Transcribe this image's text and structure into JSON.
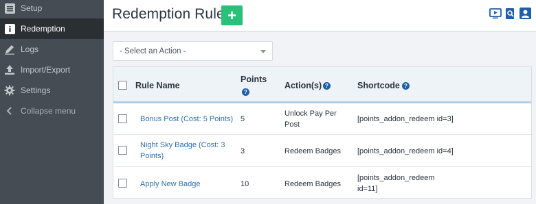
{
  "sidebar": {
    "items": [
      {
        "label": "Setup",
        "icon": "list-icon"
      },
      {
        "label": "Redemption",
        "icon": "info-icon",
        "active": true
      },
      {
        "label": "Logs",
        "icon": "pencil-icon"
      },
      {
        "label": "Import/Export",
        "icon": "upload-icon"
      },
      {
        "label": "Settings",
        "icon": "gear-icon"
      }
    ],
    "collapse_label": "Collapse menu"
  },
  "header": {
    "title": "Redemption Rules",
    "add_button_symbol": "+",
    "icons": [
      "video-icon",
      "search-doc-icon",
      "user-icon"
    ]
  },
  "action_select": {
    "selected": "- Select an Action -"
  },
  "table": {
    "columns": {
      "rule_name": "Rule Name",
      "points": "Points",
      "actions": "Action(s)",
      "shortcode": "Shortcode"
    },
    "help_symbol": "?",
    "rows": [
      {
        "name_line1": "Bonus Post (Cost: 5 Points)",
        "name_line2": "",
        "points": "5",
        "action_line1": "Unlock Pay Per",
        "action_line2": "Post",
        "shortcode_line1": "[points_addon_redeem id=3]",
        "shortcode_line2": ""
      },
      {
        "name_line1": "Night Sky Badge (Cost: 3",
        "name_line2": "Points)",
        "points": "3",
        "action_line1": "Redeem Badges",
        "action_line2": "",
        "shortcode_line1": "[points_addon_redeem id=4]",
        "shortcode_line2": ""
      },
      {
        "name_line1": "Apply New Badge",
        "name_line2": "",
        "points": "10",
        "action_line1": "Redeem Badges",
        "action_line2": "",
        "shortcode_line1": "[points_addon_redeem",
        "shortcode_line2": "id=11]"
      }
    ]
  },
  "colors": {
    "sidebar_bg": "#454c54",
    "sidebar_active_bg": "#2a2f34",
    "add_button": "#2bc07a",
    "link": "#2e6fb4",
    "help_icon": "#1d5fa8"
  }
}
